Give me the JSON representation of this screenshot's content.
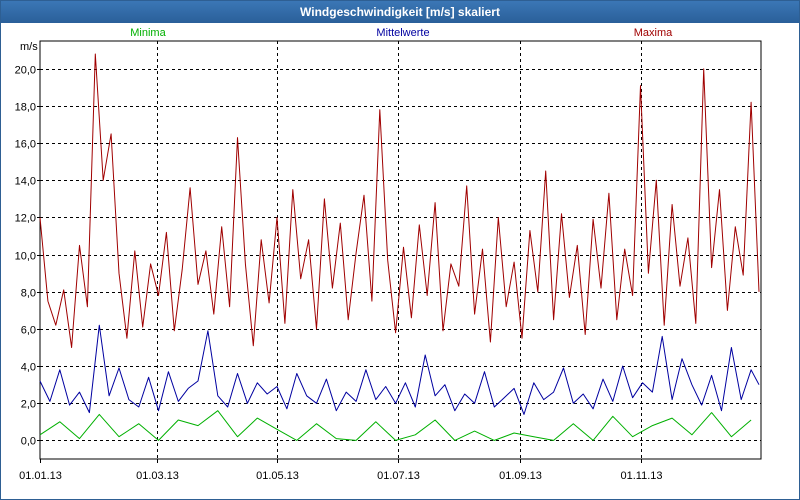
{
  "window": {
    "title": "Windgeschwindigkeit [m/s] skaliert"
  },
  "chart_data": {
    "type": "line",
    "title": "Windgeschwindigkeit [m/s] skaliert",
    "ylabel": "m/s",
    "ylim": [
      -1.0,
      21.5
    ],
    "yticks": [
      0,
      2,
      4,
      6,
      8,
      10,
      12,
      14,
      16,
      18,
      20
    ],
    "ytick_labels": [
      "0,0",
      "2,0",
      "4,0",
      "6,0",
      "8,0",
      "10,0",
      "12,0",
      "14,0",
      "16,0",
      "18,0",
      "20,0"
    ],
    "xlim": [
      "2013-01-01",
      "2013-12-31"
    ],
    "xticks": [
      "2013-01-01",
      "2013-03-01",
      "2013-05-01",
      "2013-07-01",
      "2013-09-01",
      "2013-11-01"
    ],
    "xtick_labels": [
      "01.01.13",
      "01.03.13",
      "01.05.13",
      "01.07.13",
      "01.09.13",
      "01.11.13"
    ],
    "grid": true,
    "legend": "top",
    "series": [
      {
        "name": "Minima",
        "color": "#00b000",
        "x": [
          "2013-01-01",
          "2013-01-11",
          "2013-01-21",
          "2013-01-31",
          "2013-02-10",
          "2013-02-20",
          "2013-03-02",
          "2013-03-12",
          "2013-03-22",
          "2013-04-01",
          "2013-04-11",
          "2013-04-21",
          "2013-05-01",
          "2013-05-11",
          "2013-05-21",
          "2013-05-31",
          "2013-06-10",
          "2013-06-20",
          "2013-06-30",
          "2013-07-10",
          "2013-07-20",
          "2013-07-30",
          "2013-08-09",
          "2013-08-19",
          "2013-08-29",
          "2013-09-08",
          "2013-09-18",
          "2013-09-28",
          "2013-10-08",
          "2013-10-18",
          "2013-10-28",
          "2013-11-07",
          "2013-11-17",
          "2013-11-27",
          "2013-12-07",
          "2013-12-17",
          "2013-12-27"
        ],
        "y": [
          0.3,
          1.0,
          0.1,
          1.4,
          0.2,
          0.9,
          0.0,
          1.1,
          0.8,
          1.6,
          0.2,
          1.2,
          0.6,
          0.0,
          0.9,
          0.1,
          0.0,
          1.0,
          0.0,
          0.3,
          1.1,
          0.0,
          0.5,
          0.0,
          0.4,
          0.2,
          0.0,
          0.9,
          0.0,
          1.3,
          0.2,
          0.8,
          1.2,
          0.3,
          1.5,
          0.2,
          1.1
        ]
      },
      {
        "name": "Mittelwerte",
        "color": "#0000a0",
        "x": [
          "2013-01-01",
          "2013-01-06",
          "2013-01-11",
          "2013-01-16",
          "2013-01-21",
          "2013-01-26",
          "2013-01-31",
          "2013-02-05",
          "2013-02-10",
          "2013-02-15",
          "2013-02-20",
          "2013-02-25",
          "2013-03-02",
          "2013-03-07",
          "2013-03-12",
          "2013-03-17",
          "2013-03-22",
          "2013-03-27",
          "2013-04-01",
          "2013-04-06",
          "2013-04-11",
          "2013-04-16",
          "2013-04-21",
          "2013-04-26",
          "2013-05-01",
          "2013-05-06",
          "2013-05-11",
          "2013-05-16",
          "2013-05-21",
          "2013-05-26",
          "2013-05-31",
          "2013-06-05",
          "2013-06-10",
          "2013-06-15",
          "2013-06-20",
          "2013-06-25",
          "2013-06-30",
          "2013-07-05",
          "2013-07-10",
          "2013-07-15",
          "2013-07-20",
          "2013-07-25",
          "2013-07-30",
          "2013-08-04",
          "2013-08-09",
          "2013-08-14",
          "2013-08-19",
          "2013-08-24",
          "2013-08-29",
          "2013-09-03",
          "2013-09-08",
          "2013-09-13",
          "2013-09-18",
          "2013-09-23",
          "2013-09-28",
          "2013-10-03",
          "2013-10-08",
          "2013-10-13",
          "2013-10-18",
          "2013-10-23",
          "2013-10-28",
          "2013-11-02",
          "2013-11-07",
          "2013-11-12",
          "2013-11-17",
          "2013-11-22",
          "2013-11-27",
          "2013-12-02",
          "2013-12-07",
          "2013-12-12",
          "2013-12-17",
          "2013-12-22",
          "2013-12-27",
          "2013-12-31"
        ],
        "y": [
          3.2,
          2.1,
          3.8,
          1.9,
          2.6,
          1.5,
          6.2,
          2.4,
          3.9,
          2.2,
          1.8,
          3.4,
          1.6,
          3.7,
          2.1,
          2.8,
          3.2,
          5.9,
          2.4,
          1.8,
          3.6,
          2.0,
          3.1,
          2.5,
          2.9,
          1.7,
          3.6,
          2.4,
          2.0,
          3.3,
          1.6,
          2.6,
          2.1,
          3.8,
          2.2,
          2.9,
          2.0,
          3.1,
          1.8,
          4.6,
          2.4,
          3.0,
          1.6,
          2.5,
          2.0,
          3.7,
          1.8,
          2.3,
          2.8,
          1.4,
          3.1,
          2.2,
          2.6,
          3.9,
          2.0,
          2.5,
          1.7,
          3.3,
          2.1,
          4.0,
          2.3,
          3.1,
          2.6,
          5.6,
          2.2,
          4.4,
          3.0,
          1.9,
          3.5,
          1.6,
          5.0,
          2.2,
          3.8,
          3.0
        ]
      },
      {
        "name": "Maxima",
        "color": "#a00000",
        "x": [
          "2013-01-01",
          "2013-01-05",
          "2013-01-09",
          "2013-01-13",
          "2013-01-17",
          "2013-01-21",
          "2013-01-25",
          "2013-01-29",
          "2013-02-02",
          "2013-02-06",
          "2013-02-10",
          "2013-02-14",
          "2013-02-18",
          "2013-02-22",
          "2013-02-26",
          "2013-03-02",
          "2013-03-06",
          "2013-03-10",
          "2013-03-14",
          "2013-03-18",
          "2013-03-22",
          "2013-03-26",
          "2013-03-30",
          "2013-04-03",
          "2013-04-07",
          "2013-04-11",
          "2013-04-15",
          "2013-04-19",
          "2013-04-23",
          "2013-04-27",
          "2013-05-01",
          "2013-05-05",
          "2013-05-09",
          "2013-05-13",
          "2013-05-17",
          "2013-05-21",
          "2013-05-25",
          "2013-05-29",
          "2013-06-02",
          "2013-06-06",
          "2013-06-10",
          "2013-06-14",
          "2013-06-18",
          "2013-06-22",
          "2013-06-26",
          "2013-06-30",
          "2013-07-04",
          "2013-07-08",
          "2013-07-12",
          "2013-07-16",
          "2013-07-20",
          "2013-07-24",
          "2013-07-28",
          "2013-08-01",
          "2013-08-05",
          "2013-08-09",
          "2013-08-13",
          "2013-08-17",
          "2013-08-21",
          "2013-08-25",
          "2013-08-29",
          "2013-09-02",
          "2013-09-06",
          "2013-09-10",
          "2013-09-14",
          "2013-09-18",
          "2013-09-22",
          "2013-09-26",
          "2013-09-30",
          "2013-10-04",
          "2013-10-08",
          "2013-10-12",
          "2013-10-16",
          "2013-10-20",
          "2013-10-24",
          "2013-10-28",
          "2013-11-01",
          "2013-11-05",
          "2013-11-09",
          "2013-11-13",
          "2013-11-17",
          "2013-11-21",
          "2013-11-25",
          "2013-11-29",
          "2013-12-03",
          "2013-12-07",
          "2013-12-11",
          "2013-12-15",
          "2013-12-19",
          "2013-12-23",
          "2013-12-27",
          "2013-12-31"
        ],
        "y": [
          12.0,
          7.5,
          6.2,
          8.1,
          5.0,
          10.5,
          7.2,
          20.8,
          14.0,
          16.5,
          9.0,
          5.5,
          10.2,
          6.1,
          9.5,
          7.8,
          11.2,
          5.9,
          9.2,
          13.6,
          8.4,
          10.2,
          6.8,
          11.5,
          7.2,
          16.3,
          9.5,
          5.1,
          10.8,
          7.4,
          12.0,
          6.3,
          13.5,
          8.7,
          10.8,
          6.0,
          13.0,
          8.2,
          11.7,
          6.5,
          10.1,
          13.2,
          7.5,
          17.8,
          9.7,
          5.8,
          10.4,
          6.6,
          11.6,
          7.8,
          12.8,
          5.9,
          9.5,
          8.3,
          13.7,
          6.8,
          10.3,
          5.3,
          12.0,
          7.2,
          9.6,
          5.5,
          11.3,
          8.0,
          14.5,
          6.5,
          12.2,
          7.7,
          10.5,
          5.7,
          11.9,
          8.2,
          13.3,
          6.5,
          10.3,
          7.8,
          19.1,
          9.0,
          14.0,
          6.2,
          12.7,
          8.3,
          10.9,
          6.3,
          20.0,
          9.3,
          13.5,
          7.0,
          11.5,
          8.9,
          18.2,
          8.0
        ]
      }
    ]
  }
}
